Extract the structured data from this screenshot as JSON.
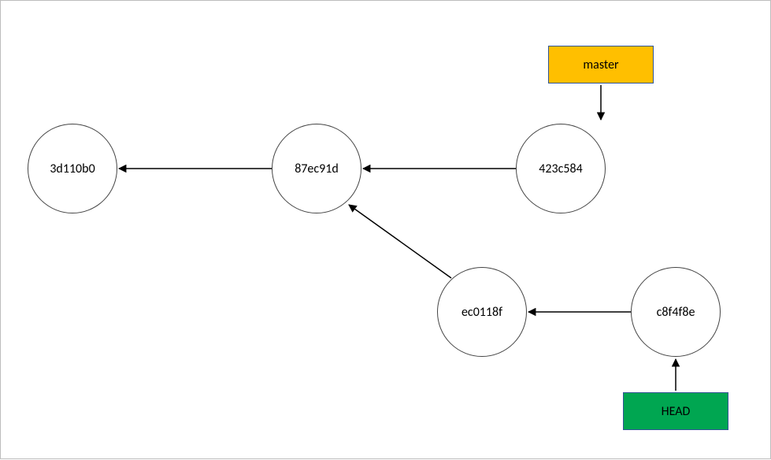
{
  "commits": {
    "c1": "3d110b0",
    "c2": "87ec91d",
    "c3": "423c584",
    "c4": "ec0118f",
    "c5": "c8f4f8e"
  },
  "refs": {
    "master": "master",
    "head": "HEAD"
  },
  "colors": {
    "master_bg": "#FFBF00",
    "head_bg": "#00A651",
    "ref_border": "#2F5597"
  }
}
